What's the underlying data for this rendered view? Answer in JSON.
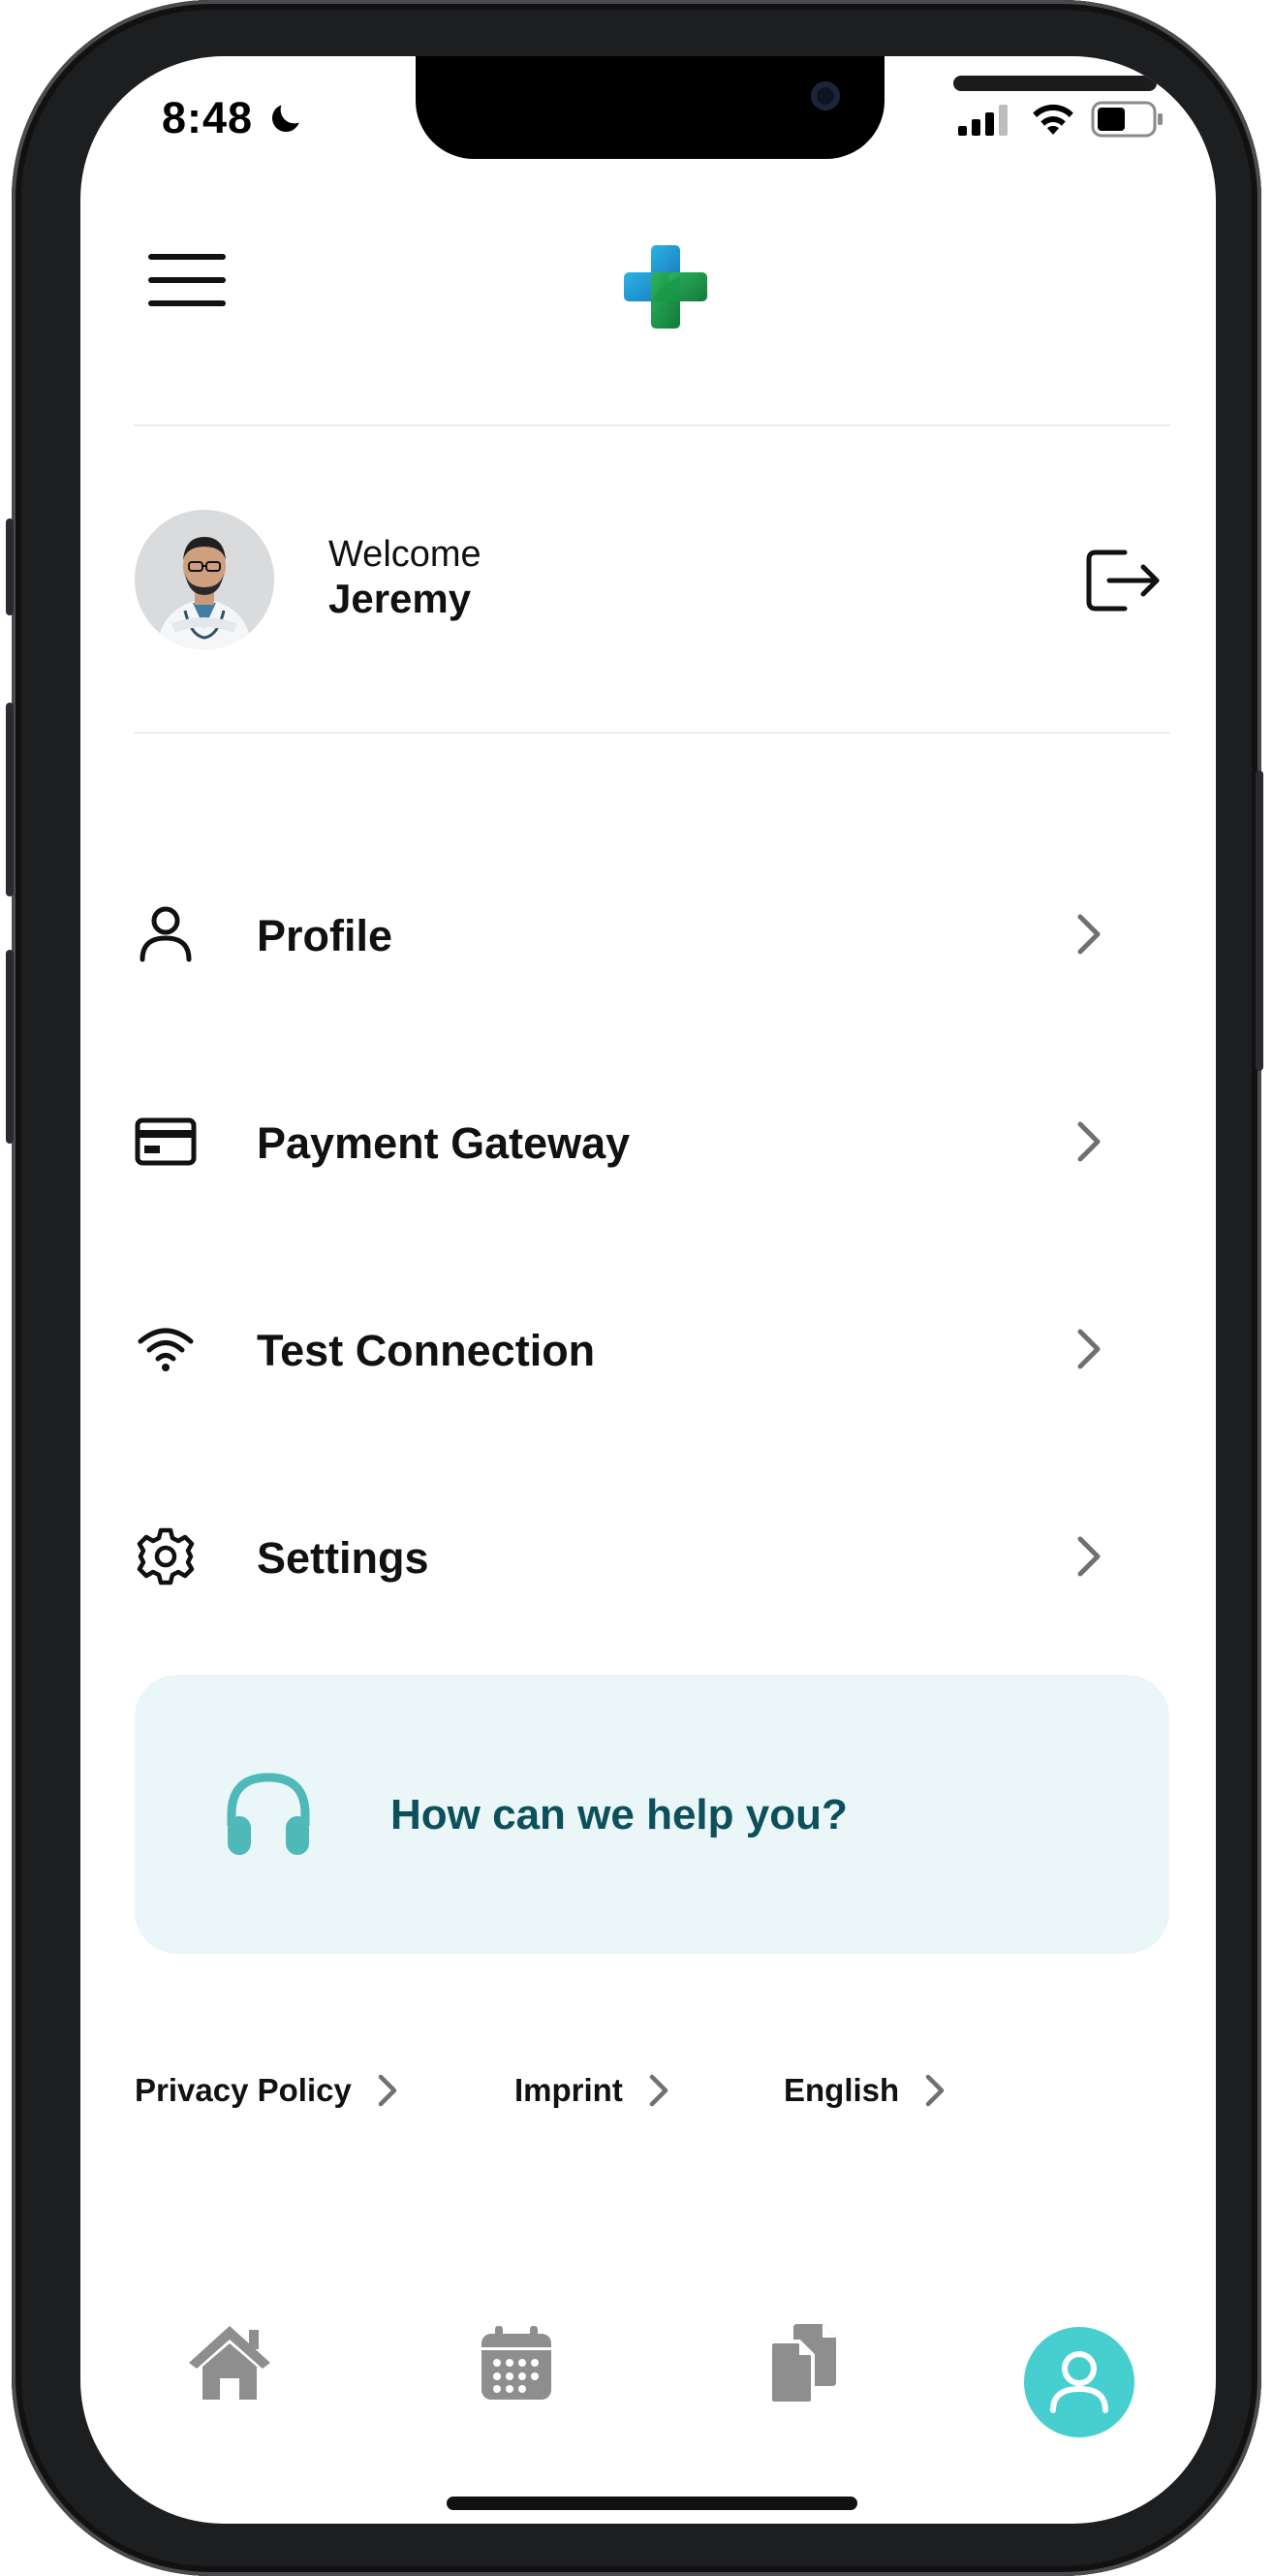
{
  "status_bar": {
    "time": "8:48",
    "focus_icon": "moon-icon",
    "signal_icon": "cellular-signal-icon",
    "wifi_icon": "wifi-icon",
    "battery_icon": "battery-icon"
  },
  "header": {
    "menu_icon": "hamburger-menu-icon",
    "logo": "medical-cross-logo",
    "logo_colors": [
      "#2a9bd6",
      "#1f9b4e"
    ]
  },
  "welcome": {
    "label": "Welcome",
    "name": "Jeremy",
    "logout_icon": "logout-icon"
  },
  "menu": {
    "items": [
      {
        "label": "Profile",
        "icon": "user-icon"
      },
      {
        "label": "Payment Gateway",
        "icon": "credit-card-icon"
      },
      {
        "label": "Test Connection",
        "icon": "wifi-icon"
      },
      {
        "label": "Settings",
        "icon": "gear-icon"
      }
    ]
  },
  "help": {
    "text": "How can we help you?",
    "icon": "headphones-icon",
    "background": "#eaf6f8",
    "text_color": "#0d4f5a",
    "icon_color": "#4fb8b9"
  },
  "footer": {
    "links": [
      "Privacy Policy",
      "Imprint",
      "English"
    ]
  },
  "tabbar": {
    "tabs": [
      {
        "icon": "home-icon",
        "active": false
      },
      {
        "icon": "calendar-icon",
        "active": false
      },
      {
        "icon": "documents-icon",
        "active": false
      },
      {
        "icon": "user-icon",
        "active": true
      }
    ],
    "active_color": "#46cfce",
    "inactive_color": "#8e8e8e"
  }
}
